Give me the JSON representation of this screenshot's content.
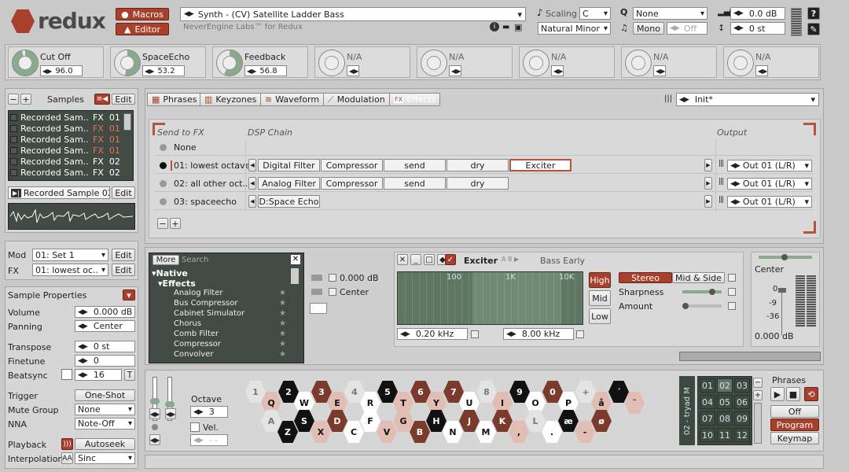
{
  "app": {
    "logo": "redux",
    "macros": "Macros",
    "editor": "Editor"
  },
  "patch": {
    "name": "Synth - (CV) Satellite Ladder Bass",
    "vendor": "NeverEngine Labs™ for Redux"
  },
  "scaling": {
    "label": "Scaling",
    "key": "C",
    "scale": "Natural Minor"
  },
  "quantize": {
    "value": "None",
    "voice": "Mono",
    "glide": "Off"
  },
  "output": {
    "gain": "0.0 dB",
    "tune": "0 st"
  },
  "macros": [
    {
      "label": "Cut Off",
      "value": "96.0"
    },
    {
      "label": "SpaceEcho",
      "value": "53.2"
    },
    {
      "label": "Feedback",
      "value": "56.8"
    },
    {
      "label": "N/A",
      "value": ""
    },
    {
      "label": "N/A",
      "value": ""
    },
    {
      "label": "N/A",
      "value": ""
    },
    {
      "label": "N/A",
      "value": ""
    },
    {
      "label": "N/A",
      "value": ""
    }
  ],
  "samples": {
    "header": "Samples",
    "edit": "Edit",
    "minus": "−",
    "plus": "+",
    "rows": [
      {
        "name": "Recorded Sam..",
        "fx": "FX  01",
        "red": false
      },
      {
        "name": "Recorded Sam..",
        "fx": "FX  01",
        "red": true
      },
      {
        "name": "Recorded Sam..",
        "fx": "FX  01",
        "red": true
      },
      {
        "name": "Recorded Sam..",
        "fx": "FX  01",
        "red": true
      },
      {
        "name": "Recorded Sam..",
        "fx": "FX  02",
        "red": false
      },
      {
        "name": "Recorded Sam..",
        "fx": "FX  02",
        "red": false
      }
    ],
    "selected": "Recorded Sample 02 s..",
    "sel_edit": "Edit"
  },
  "modfx": {
    "mod_label": "Mod",
    "mod_value": "01: Set 1",
    "fx_label": "FX",
    "fx_value": "01: lowest oc..",
    "edit": "Edit"
  },
  "props": {
    "title": "Sample Properties",
    "volume": {
      "label": "Volume",
      "value": "0.000 dB"
    },
    "panning": {
      "label": "Panning",
      "value": "Center"
    },
    "transpose": {
      "label": "Transpose",
      "value": "0 st"
    },
    "finetune": {
      "label": "Finetune",
      "value": "0"
    },
    "beatsync": {
      "label": "Beatsync",
      "value": "16",
      "t": "T"
    },
    "trigger": {
      "label": "Trigger",
      "value": "One-Shot"
    },
    "mute": {
      "label": "Mute Group",
      "value": "None"
    },
    "nna": {
      "label": "NNA",
      "value": "Note-Off"
    },
    "playback": {
      "label": "Playback",
      "value": "Autoseek"
    },
    "interp": {
      "label": "Interpolation",
      "aa": "AA",
      "value": "Sinc"
    }
  },
  "tabs": [
    "Phrases",
    "Keyzones",
    "Waveform",
    "Modulation",
    "Effects"
  ],
  "preset": "Init*",
  "fxpanel": {
    "send_header": "Send to FX",
    "dsp_header": "DSP Chain",
    "out_header": "Output",
    "rows": [
      {
        "name": "None",
        "chain": [],
        "out": ""
      },
      {
        "name": "01: lowest octave",
        "chain": [
          "Digital Filter",
          "Compressor",
          "send",
          "dry",
          "Exciter"
        ],
        "out": "Out 01 (L/R)"
      },
      {
        "name": "02: all other oct..",
        "chain": [
          "Analog Filter",
          "Compressor",
          "send",
          "dry"
        ],
        "out": "Out 01 (L/R)"
      },
      {
        "name": "03: spaceecho",
        "chain": [
          "D:Space Echo"
        ],
        "out": "Out 01 (L/R)"
      }
    ]
  },
  "browser": {
    "more": "More",
    "search": "Search",
    "native": "Native",
    "effects": "Effects",
    "items": [
      "Analog Filter",
      "Bus Compressor",
      "Cabinet Simulator",
      "Chorus",
      "Comb Filter",
      "Compressor",
      "Convolver"
    ]
  },
  "behind": {
    "gain": "0.000 dB",
    "pan": "Center"
  },
  "exciter": {
    "title": "Exciter",
    "preset": "Bass Early",
    "x100": "100",
    "x1k": "1K",
    "x10k": "10K",
    "low_freq": "0.20 kHz",
    "high_freq": "8.00 kHz",
    "high": "High",
    "mid": "Mid",
    "low": "Low",
    "stereo": "Stereo",
    "midside": "Mid & Side",
    "sharpness": "Sharpness",
    "amount": "Amount"
  },
  "meter": {
    "center": "Center",
    "m0": "0",
    "m9": "-9",
    "m36": "-36",
    "db": "0.000 dB"
  },
  "keyboard": {
    "octave_label": "Octave",
    "octave": "3",
    "vel": "Vel.",
    "dash": "- -",
    "row1": [
      "1",
      "2",
      "3",
      "4",
      "5",
      "6",
      "7",
      "8",
      "9",
      "0",
      "+",
      "´"
    ],
    "row2": [
      "Q",
      "W",
      "E",
      "R",
      "T",
      "Y",
      "U",
      "I",
      "O",
      "P",
      "å",
      "¨"
    ],
    "row3": [
      "A",
      "S",
      "D",
      "F",
      "G",
      "H",
      "J",
      "K",
      "L",
      "æ",
      "ø"
    ],
    "row4": [
      "Z",
      "X",
      "C",
      "V",
      "B",
      "N",
      "M",
      ",",
      ".",
      "-"
    ]
  },
  "phrases": {
    "vtitle": "02 - tryad M",
    "label": "Phrases",
    "pads": [
      "01",
      "02",
      "03",
      "04",
      "05",
      "06",
      "07",
      "08",
      "09",
      "10",
      "11",
      "12"
    ],
    "off": "Off",
    "program": "Program",
    "keymap": "Keymap"
  }
}
